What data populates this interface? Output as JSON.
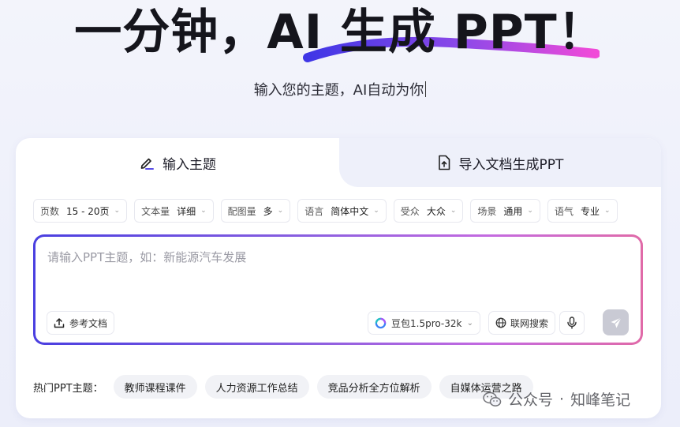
{
  "hero": {
    "title": "一分钟，AI 生成 PPT！",
    "subtitle": "输入您的主题，AI自动为你"
  },
  "tabs": [
    {
      "label": "输入主题",
      "icon": "pen-icon",
      "active": true
    },
    {
      "label": "导入文档生成PPT",
      "icon": "file-upload-icon",
      "active": false
    }
  ],
  "options": [
    {
      "key": "页数",
      "value": "15 - 20页"
    },
    {
      "key": "文本量",
      "value": "详细"
    },
    {
      "key": "配图量",
      "value": "多"
    },
    {
      "key": "语言",
      "value": "简体中文"
    },
    {
      "key": "受众",
      "value": "大众"
    },
    {
      "key": "场景",
      "value": "通用"
    },
    {
      "key": "语气",
      "value": "专业"
    }
  ],
  "input": {
    "value": "",
    "placeholder": "请输入PPT主题，如：新能源汽车发展"
  },
  "toolbar": {
    "reference_doc": "参考文档",
    "model": "豆包1.5pro-32k",
    "web_search": "联网搜索"
  },
  "hot_topics": {
    "label": "热门PPT主题：",
    "items": [
      "教师课程课件",
      "人力资源工作总结",
      "竞品分析全方位解析",
      "自媒体运营之路"
    ]
  },
  "watermark": {
    "prefix": "公众号",
    "separator": "·",
    "name": "知峰笔记"
  },
  "colors": {
    "gradient_start": "#4a3fe0",
    "gradient_end": "#e06aa8",
    "send_disabled": "#c9cad4"
  }
}
